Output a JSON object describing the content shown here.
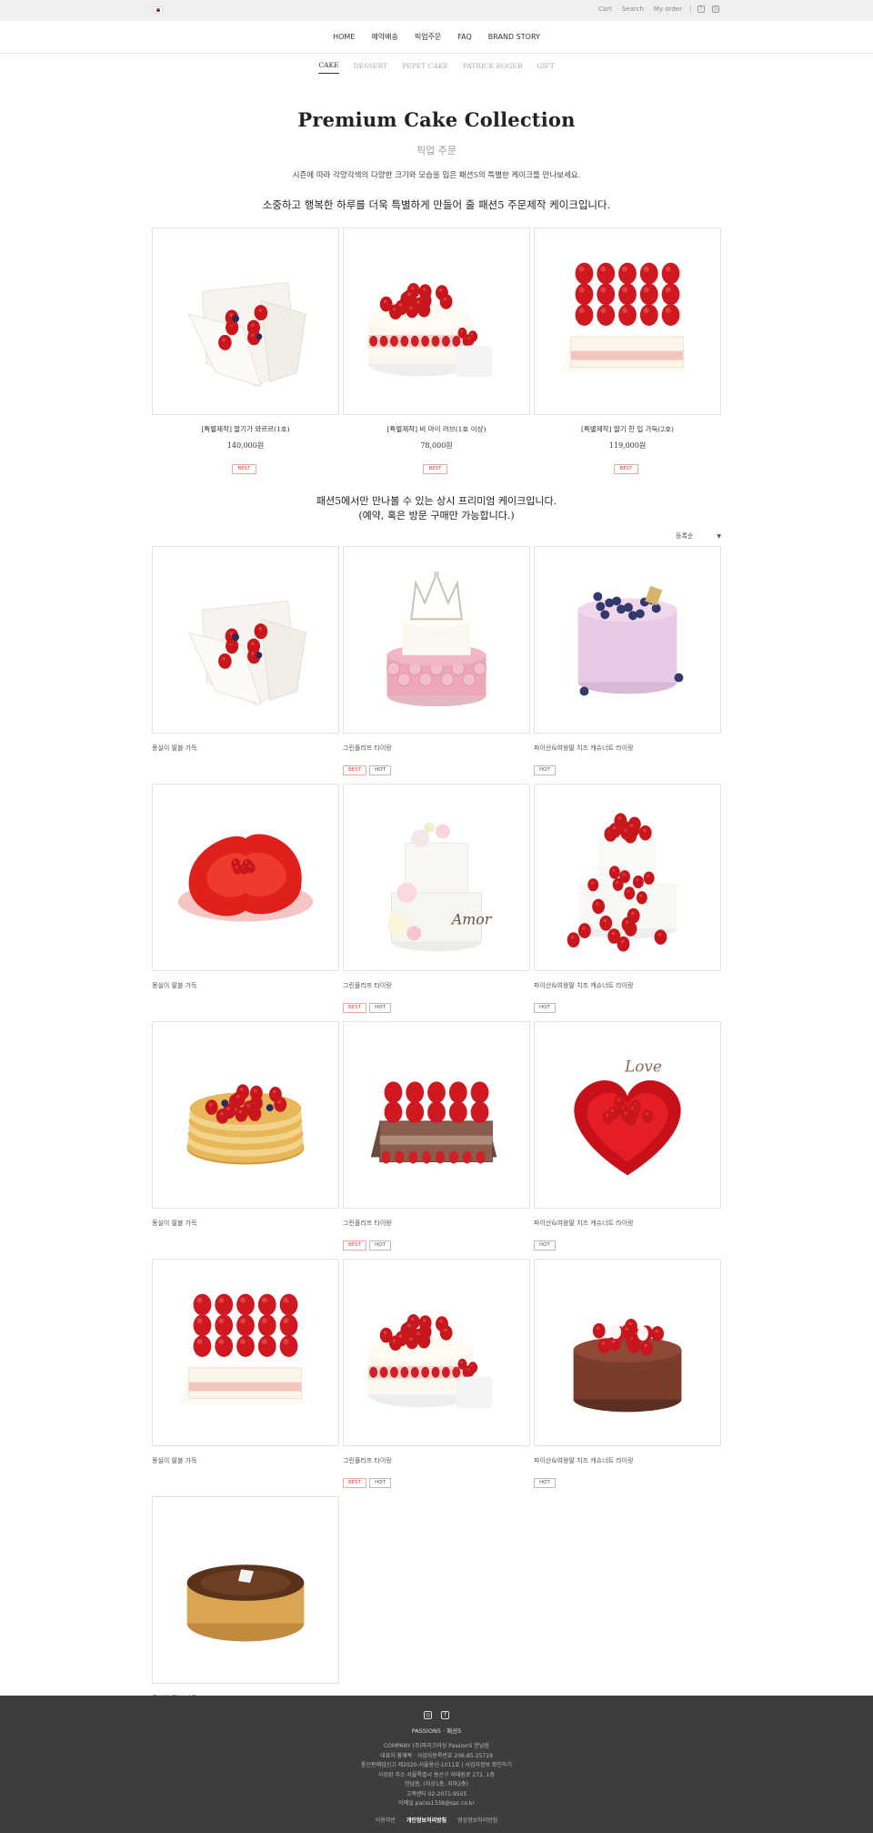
{
  "topbar": {
    "links": [
      "Cart",
      "Search",
      "My order"
    ],
    "icons": [
      "facebook-icon",
      "instagram-icon"
    ]
  },
  "nav": {
    "items": [
      "HOME",
      "예약배송",
      "픽업주문",
      "FAQ",
      "BRAND STORY"
    ]
  },
  "subnav": {
    "tabs": [
      "CAKE",
      "DESSERT",
      "PEPET CAKE",
      "PATRICK ROGER",
      "GIFT"
    ],
    "active": "CAKE"
  },
  "page": {
    "title": "Premium Cake Collection",
    "subtitle": "픽업 주문",
    "description": "시즌에 따라 각양각색의 다양한 크기와 모습을 입은 패션5의 특별한 케이크를 만나보세요.",
    "headline": "소중하고 행복한 하루를 더욱 특별하게 만들어 줄 패션5 주문제작 케이크입니다."
  },
  "featured": [
    {
      "name": "[특별제작] 딸기가 와르르(1호)",
      "price": "140,000원",
      "badges": [
        "BEST"
      ],
      "image": "cake-bouquet"
    },
    {
      "name": "[특별제작] 비 마이 러브(1호 이상)",
      "price": "78,000원",
      "badges": [
        "BEST"
      ],
      "image": "cake-tier"
    },
    {
      "name": "[특별제작] 딸기 한 입 가득(2호)",
      "price": "119,000원",
      "badges": [
        "BEST"
      ],
      "image": "cake-square"
    }
  ],
  "middle": {
    "line1": "패션5에서만 만나볼 수 있는 상시 프리미엄 케이크입니다.",
    "line2": "(예약, 혹은 방문 구매만 가능합니다.)"
  },
  "sort": {
    "label": "등록순"
  },
  "products": [
    {
      "name": "몽실이 딸블 가득",
      "badges": [],
      "image": "cake-bouquet"
    },
    {
      "name": "그린플리프 타이랑",
      "badges": [
        "BEST",
        "HOT"
      ],
      "image": "cake-crown"
    },
    {
      "name": "파이산&여왕딸 치즈 캐슈너트 라이랑",
      "badges": [
        "HOT"
      ],
      "image": "cake-pink"
    },
    {
      "name": "몽실이 딸블 가득",
      "badges": [],
      "image": "cake-rose"
    },
    {
      "name": "그린플리프 타이랑",
      "badges": [
        "BEST",
        "HOT"
      ],
      "image": "cake-flower"
    },
    {
      "name": "파이산&여왕딸 치즈 캐슈너트 라이랑",
      "badges": [
        "HOT"
      ],
      "image": "cake-twotier"
    },
    {
      "name": "몽실이 딸블 가득",
      "badges": [],
      "image": "cake-crepe"
    },
    {
      "name": "그린플리프 타이랑",
      "badges": [
        "BEST",
        "HOT"
      ],
      "image": "cake-choco-square"
    },
    {
      "name": "파이산&여왕딸 치즈 캐슈너트 라이랑",
      "badges": [
        "HOT"
      ],
      "image": "cake-heart"
    },
    {
      "name": "몽실이 딸블 가득",
      "badges": [],
      "image": "cake-square"
    },
    {
      "name": "그린플리프 타이랑",
      "badges": [
        "BEST",
        "HOT"
      ],
      "image": "cake-tier"
    },
    {
      "name": "파이산&여왕딸 치즈 캐슈너트 라이랑",
      "badges": [
        "HOT"
      ],
      "image": "cake-choco-round"
    },
    {
      "name": "몽실이 딸블 가득",
      "badges": [],
      "image": "cake-basque"
    }
  ],
  "footer": {
    "brand": "PASSION5 · 패션5",
    "info": [
      "COMPANY (주)파리크라상 Passion5 한남점",
      "대표자 황재복 · 사업자등록번호 206-85-25719",
      "통신판매업신고 제2020-서울용산-1011호 | 사업자정보 확인하기",
      "사업장 주소 서울특별시 용산구 이태원로 272, 1층",
      "한남동, (지상1층, 지하2층)",
      "고객센터 02-2071-9505",
      "이메일 pacss1338@spc.co.kr"
    ],
    "links": [
      "이용약관",
      "개인정보처리방침",
      "영상정보처리방침"
    ]
  },
  "colors": {
    "best": "#e0463c",
    "footer_bg": "#3d3d3d",
    "topbar_bg": "#efefef"
  }
}
